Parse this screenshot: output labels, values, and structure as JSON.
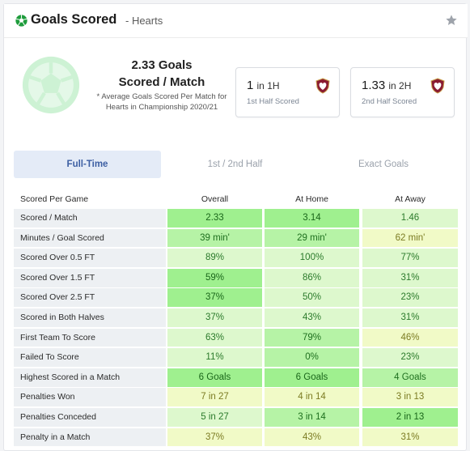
{
  "header": {
    "title": "Goals Scored",
    "subtitle": "- Hearts"
  },
  "summary": {
    "value_line1": "2.33 Goals",
    "value_line2": "Scored / Match",
    "desc_line1": "* Average Goals Scored Per Match for",
    "desc_line2": "Hearts in Championship 2020/21"
  },
  "halves": [
    {
      "value": "1",
      "suffix": "in 1H",
      "label": "1st Half Scored"
    },
    {
      "value": "1.33",
      "suffix": "in 2H",
      "label": "2nd Half Scored"
    }
  ],
  "tabs": [
    {
      "label": "Full-Time",
      "active": true
    },
    {
      "label": "1st / 2nd Half",
      "active": false
    },
    {
      "label": "Exact Goals",
      "active": false
    }
  ],
  "table": {
    "headers": [
      "Scored Per Game",
      "Overall",
      "At Home",
      "At Away"
    ],
    "rows": [
      {
        "label": "Scored / Match",
        "values": [
          "2.33",
          "3.14",
          "1.46"
        ],
        "levels": [
          0.8,
          1.0,
          0.3
        ]
      },
      {
        "label": "Minutes / Goal Scored",
        "values": [
          "39 min'",
          "29 min'",
          "62 min'"
        ],
        "levels": [
          0.5,
          0.65,
          0.1
        ]
      },
      {
        "label": "Scored Over 0.5 FT",
        "values": [
          "89%",
          "100%",
          "77%"
        ],
        "levels": [
          0.4,
          0.45,
          0.35
        ]
      },
      {
        "label": "Scored Over 1.5 FT",
        "values": [
          "59%",
          "86%",
          "31%"
        ],
        "levels": [
          0.8,
          0.4,
          0.3
        ]
      },
      {
        "label": "Scored Over 2.5 FT",
        "values": [
          "37%",
          "50%",
          "23%"
        ],
        "levels": [
          0.8,
          0.4,
          0.3
        ]
      },
      {
        "label": "Scored in Both Halves",
        "values": [
          "37%",
          "43%",
          "31%"
        ],
        "levels": [
          0.4,
          0.4,
          0.3
        ]
      },
      {
        "label": "First Team To Score",
        "values": [
          "63%",
          "79%",
          "46%"
        ],
        "levels": [
          0.4,
          0.55,
          0.1
        ]
      },
      {
        "label": "Failed To Score",
        "values": [
          "11%",
          "0%",
          "23%"
        ],
        "levels": [
          0.4,
          0.65,
          0.3
        ]
      },
      {
        "label": "Highest Scored in a Match",
        "values": [
          "6 Goals",
          "6 Goals",
          "4 Goals"
        ],
        "levels": [
          0.8,
          0.8,
          0.6
        ]
      },
      {
        "label": "Penalties Won",
        "values": [
          "7 in 27",
          "4 in 14",
          "3 in 13"
        ],
        "levels": [
          0.1,
          0.1,
          0.1
        ]
      },
      {
        "label": "Penalties Conceded",
        "values": [
          "5 in 27",
          "3 in 14",
          "2 in 13"
        ],
        "levels": [
          0.4,
          0.55,
          0.8
        ]
      },
      {
        "label": "Penalty in a Match",
        "values": [
          "37%",
          "43%",
          "31%"
        ],
        "levels": [
          0.1,
          0.1,
          0.1
        ]
      }
    ]
  },
  "colors": {
    "level_ramp": [
      "#f1fac7",
      "#ddf8cd",
      "#b6f3a6",
      "#9ff08f"
    ],
    "text_ramp": [
      "#7b7b22",
      "#2b7a2b",
      "#1e6f1e",
      "#1a661a"
    ],
    "brand_green": "#1e9c3c"
  }
}
